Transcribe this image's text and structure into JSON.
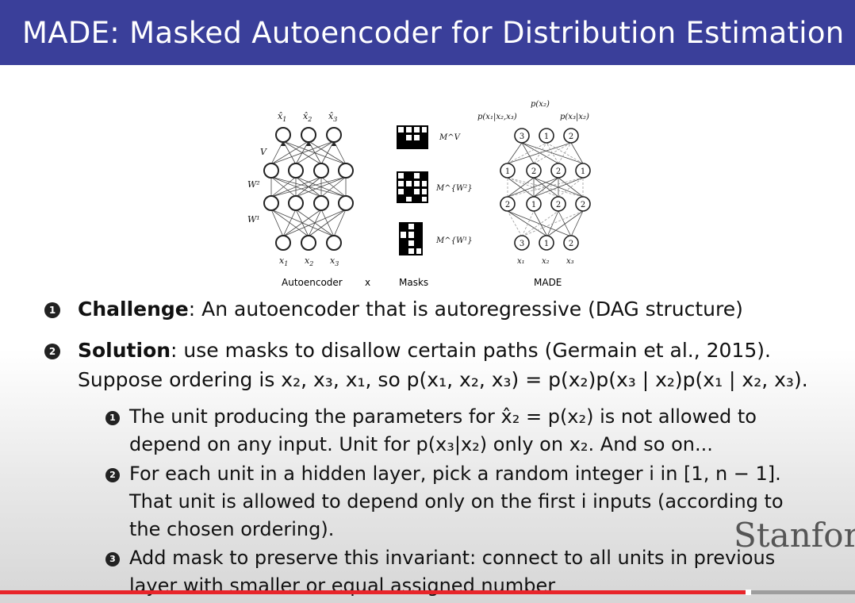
{
  "slide": {
    "title": "MADE: Masked Autoencoder for Distribution Estimation"
  },
  "figure": {
    "autoencoder": {
      "outputs": [
        "x̂",
        "x̂",
        "x̂"
      ],
      "output_subs": [
        "1",
        "2",
        "3"
      ],
      "inputs": [
        "x",
        "x",
        "x"
      ],
      "input_subs": [
        "1",
        "2",
        "3"
      ],
      "weights": [
        "V",
        "W²",
        "W¹"
      ],
      "caption": "Autoencoder"
    },
    "times": "x",
    "masks": {
      "labels": [
        "M^V",
        "M^{W²}",
        "M^{W¹}"
      ],
      "caption": "Masks"
    },
    "made": {
      "top_label": "p(x₂)",
      "left_label": "p(x₁|x₂,x₃)",
      "right_label": "p(x₃|x₂)",
      "output_numbers": [
        "3",
        "1",
        "2"
      ],
      "hidden2_numbers": [
        "1",
        "2",
        "2",
        "1"
      ],
      "hidden1_numbers": [
        "2",
        "1",
        "2",
        "2"
      ],
      "input_numbers": [
        "3",
        "1",
        "2"
      ],
      "inputs": [
        "x₁",
        "x₂",
        "x₃"
      ],
      "caption": "MADE"
    }
  },
  "bullets": [
    {
      "num": "1",
      "bold": "Challenge",
      "rest": ": An autoencoder that is autoregressive (DAG structure)"
    },
    {
      "num": "2",
      "bold": "Solution",
      "rest": ": use masks to disallow certain paths (Germain et al., 2015).",
      "line2": "Suppose ordering is x₂, x₃, x₁, so p(x₁, x₂, x₃) = p(x₂)p(x₃ | x₂)p(x₁ | x₂, x₃)."
    }
  ],
  "subbullets": [
    {
      "num": "1",
      "lines": [
        "The unit producing the parameters for x̂₂ = p(x₂) is not allowed to",
        "depend on any input. Unit for p(x₃|x₂) only on x₂. And so on..."
      ]
    },
    {
      "num": "2",
      "lines": [
        "For each unit in a hidden layer, pick a random integer i in [1, n − 1].",
        "That unit is allowed to depend only on the first i inputs (according to",
        "the chosen ordering)."
      ]
    },
    {
      "num": "3",
      "lines": [
        "Add mask to preserve this invariant: connect to all units in previous",
        "layer with smaller or equal assigned number"
      ]
    }
  ],
  "watermark": "Stanfor",
  "video": {
    "progress": 0.872
  }
}
